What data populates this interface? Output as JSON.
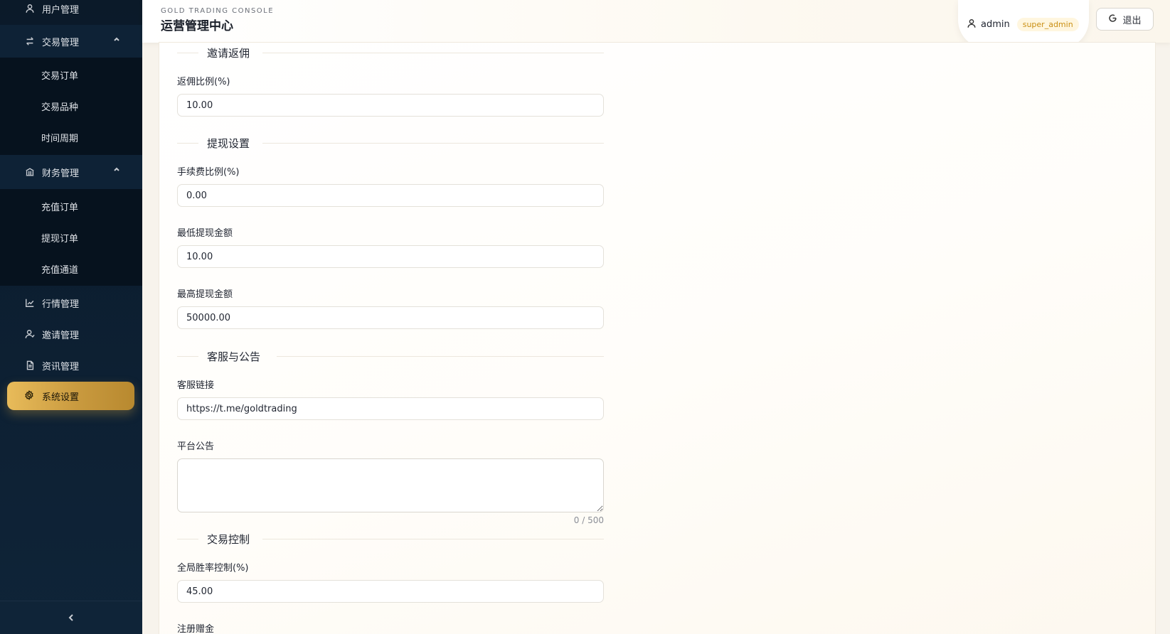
{
  "sidebar": {
    "items": [
      {
        "label": "用户管理",
        "icon": "user-icon"
      },
      {
        "label": "交易管理",
        "icon": "exchange-icon",
        "expanded": true,
        "children": [
          "交易订单",
          "交易品种",
          "时间周期"
        ]
      },
      {
        "label": "财务管理",
        "icon": "bank-icon",
        "expanded": true,
        "children": [
          "充值订单",
          "提现订单",
          "充值通道"
        ]
      },
      {
        "label": "行情管理",
        "icon": "chart-line-icon"
      },
      {
        "label": "邀请管理",
        "icon": "invite-user-icon"
      },
      {
        "label": "资讯管理",
        "icon": "document-icon"
      },
      {
        "label": "系统设置",
        "icon": "gear-icon",
        "active": true
      }
    ],
    "collapse_icon": "chevron-left-icon"
  },
  "header": {
    "brand_sub": "GOLD TRADING CONSOLE",
    "brand_title": "运营管理中心",
    "user_name": "admin",
    "role": "super_admin",
    "logout_label": "退出"
  },
  "form": {
    "sections": {
      "invite": "邀请返佣",
      "withdraw": "提现设置",
      "service": "客服与公告",
      "trade": "交易控制"
    },
    "fields": {
      "rebate_ratio": {
        "label": "返佣比例(%)",
        "value": "10.00"
      },
      "fee_ratio": {
        "label": "手续费比例(%)",
        "value": "0.00"
      },
      "min_withdraw": {
        "label": "最低提现金额",
        "value": "10.00"
      },
      "max_withdraw": {
        "label": "最高提现金额",
        "value": "50000.00"
      },
      "service_link": {
        "label": "客服链接",
        "value": "https://t.me/goldtrading"
      },
      "announcement": {
        "label": "平台公告",
        "value": "",
        "counter": "0 / 500"
      },
      "win_rate": {
        "label": "全局胜率控制(%)",
        "value": "45.00"
      },
      "register_bonus": {
        "label": "注册赠金"
      }
    }
  },
  "colors": {
    "sidebar_bg": "#0d2033",
    "accent_gold": "#c99a3f",
    "role_badge": "#c98f14"
  }
}
